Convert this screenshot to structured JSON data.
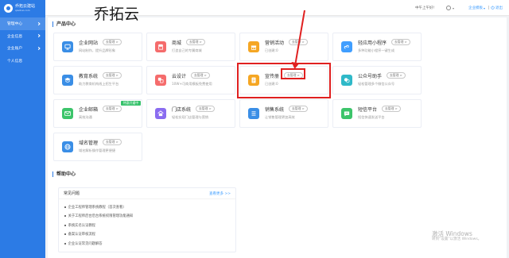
{
  "colors": {
    "primary": "#2c7be5",
    "link": "#409eff",
    "annotation": "#e02020"
  },
  "sidebar": {
    "logo_title": "乔拓云建站",
    "logo_sub": "qiaotuo.com",
    "items": [
      {
        "label": "管理中心",
        "active": true
      },
      {
        "label": "企业信息"
      },
      {
        "label": "企业账户"
      },
      {
        "label": "个人信息"
      }
    ]
  },
  "header": {
    "greeting": "中午上午好!",
    "template_label": "企业模板",
    "logout_label": "退出"
  },
  "annotation": {
    "title": "乔拓云"
  },
  "product_center": {
    "title": "产品中心",
    "cards": [
      {
        "name": "企业网站",
        "action": "去管理 >",
        "desc": "网站制作，提升品牌形象",
        "icon": "monitor-icon",
        "color": "#3a8ee6"
      },
      {
        "name": "商城",
        "action": "去管理 >",
        "desc": "打造自己的专属商城",
        "icon": "shop-icon",
        "color": "#f56c6c"
      },
      {
        "name": "营销活动",
        "action": "去管理 >",
        "desc": "已创建:0",
        "icon": "gift-icon",
        "color": "#f5a623"
      },
      {
        "name": "轻应用小程序",
        "action": "去管理 >",
        "desc": "多种功能小程序一键生成",
        "icon": "mini-program-icon",
        "color": "#409eff"
      },
      {
        "name": "教育系统",
        "action": "去管理 >",
        "desc": "助力教育机构线上招生平台",
        "icon": "education-icon",
        "color": "#3a8ee6"
      },
      {
        "name": "云设计",
        "action": "去管理 >",
        "desc": "10W+可商用模板免费使用",
        "icon": "cloud-design-icon",
        "color": "#f56c6c"
      },
      {
        "name": "宣传册",
        "action": "去管理 >",
        "desc": "已创建:0",
        "icon": "brochure-icon",
        "color": "#f5a623"
      },
      {
        "name": "公众号助手",
        "action": "去管理 >",
        "desc": "轻松管理多个微信公众号",
        "icon": "wechat-official-icon",
        "color": "#2fb9c8"
      },
      {
        "name": "企业邮箱",
        "action": "去管理 >",
        "desc": "高效沟通",
        "icon": "email-icon",
        "color": "#3cc46a",
        "badge": "特惠开通中"
      },
      {
        "name": "门店系统",
        "action": "去管理 >",
        "desc": "轻松实现门店管理与营销",
        "icon": "store-icon",
        "color": "#8a6cf0"
      },
      {
        "name": "销售系统",
        "action": "去管理 >",
        "desc": "让销售管理更加高效",
        "icon": "sales-icon",
        "color": "#3a8ee6"
      },
      {
        "name": "短信平台",
        "action": "去管理 >",
        "desc": "短信快速发送平台",
        "icon": "sms-icon",
        "color": "#3cc46a"
      },
      {
        "name": "域名管理",
        "action": "去管理 >",
        "desc": "域名解析操作管理更便捷",
        "icon": "domain-icon",
        "color": "#3a8ee6"
      }
    ]
  },
  "help_center": {
    "title": "帮助中心",
    "faq_title": "常见问题",
    "more_label": "查看更多 >>",
    "items": [
      "企业工程师管理系统教程（首次查看）",
      "关于工程师后台后台系统权限管理功能通知",
      "系统实名认证教程",
      "备案认证审核流程",
      "企业认证常见问题解答"
    ]
  },
  "watermark": {
    "line1": "激活 Windows",
    "line2": "转到“设置”以激活 Windows。"
  }
}
